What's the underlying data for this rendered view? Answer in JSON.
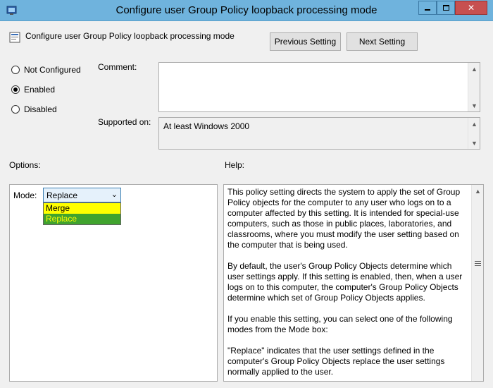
{
  "window": {
    "title": "Configure user Group Policy loopback processing mode",
    "controls": {
      "minimize": "minimize",
      "maximize": "maximize",
      "close": "✕"
    }
  },
  "header": {
    "setting_name": "Configure user Group Policy loopback processing mode",
    "previous_label": "Previous Setting",
    "next_label": "Next Setting"
  },
  "state": {
    "options": [
      {
        "label": "Not Configured",
        "checked": false
      },
      {
        "label": "Enabled",
        "checked": true
      },
      {
        "label": "Disabled",
        "checked": false
      }
    ]
  },
  "comment": {
    "label": "Comment:",
    "value": ""
  },
  "supported": {
    "label": "Supported on:",
    "value": "At least Windows 2000"
  },
  "options_section": {
    "label": "Options:",
    "mode_label": "Mode:",
    "mode_value": "Replace",
    "dropdown_items": [
      "Merge",
      "Replace"
    ]
  },
  "help_section": {
    "label": "Help:",
    "paragraphs": [
      "This policy setting directs the system to apply the set of Group Policy objects for the computer to any user who logs on to a computer affected by this setting. It is intended for special-use computers, such as those in public places, laboratories, and classrooms, where you must modify the user setting based on the computer that is being used.",
      "By default, the user's Group Policy Objects determine which user settings apply. If this setting is enabled, then, when a user logs on to this computer, the computer's Group Policy Objects determine which set of Group Policy Objects applies.",
      "If you enable this setting, you can select one of the following modes from the Mode box:",
      "\"Replace\" indicates that the user settings defined in the computer's Group Policy Objects replace the user settings normally applied to the user."
    ]
  },
  "colors": {
    "titlebar": "#6fb3dd",
    "merge_highlight": "#ffff00",
    "replace_highlight": "#40a32e"
  }
}
